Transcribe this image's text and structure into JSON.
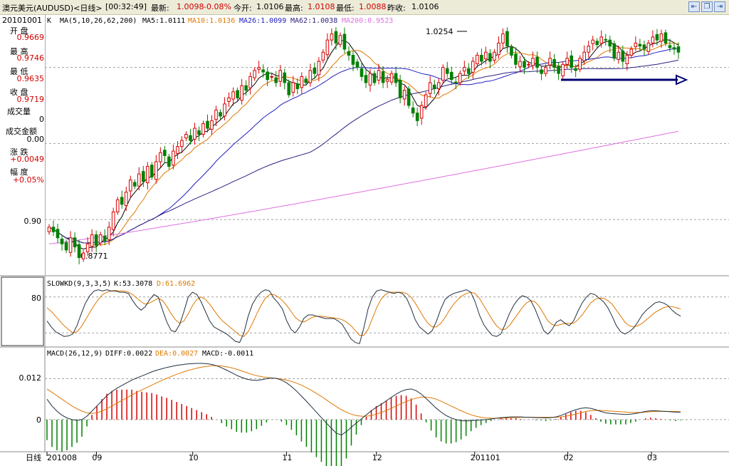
{
  "header": {
    "title": "澳元美元(AUDUSD)<日线>",
    "time": "[00:32:49]",
    "latest_label": "最新:",
    "latest_value": "1.0098",
    "latest_change": "-0.08%",
    "open_label": "今开:",
    "open_value": "1.0106",
    "high_label": "最高:",
    "high_value": "1.0108",
    "low_label": "最低:",
    "low_value": "1.0088",
    "prev_label": "昨收:",
    "prev_value": "1.0106"
  },
  "info_panel": {
    "date": "20101001",
    "k_label": "K",
    "open_label": "开  盘",
    "open_value": "0.9669",
    "high_label": "最  高",
    "high_value": "0.9746",
    "low_label": "最  低",
    "low_value": "0.9635",
    "close_label": "收  盘",
    "close_value": "0.9719",
    "volume_label": "成交量",
    "volume_value": "0",
    "amount_label": "成交金额",
    "amount_value": "0.00",
    "change_label": "涨  跌",
    "change_value": "+0.0049",
    "pct_label": "幅  度",
    "pct_value": "+0.05%"
  },
  "colors": {
    "up": "#d80000",
    "down": "#008000",
    "ma5": "#000000",
    "ma10": "#e07800",
    "ma26": "#2020c0",
    "ma62": "#302080",
    "ma200": "#e070e0",
    "k_line": "#203040",
    "d_line": "#e07800",
    "diff": "#203040",
    "dea": "#e07800",
    "arrow": "#000070",
    "grid": "#a0a0a0"
  },
  "chart_data": [
    {
      "type": "candlestick",
      "legend": {
        "ma_params": "MA(5,10,26,62,200)",
        "ma5": "MA5:1.0111",
        "ma10": "MA10:1.0136",
        "ma26": "MA26:1.0099",
        "ma62": "MA62:1.0038",
        "ma200": "MA200:0.9523"
      },
      "y_ticks": [
        "0.90"
      ],
      "ylim": [
        0.864,
        1.034
      ],
      "annotations": {
        "high": "1.0254",
        "low": "0.8771"
      },
      "closes": [
        0.895,
        0.892,
        0.888,
        0.884,
        0.88,
        0.888,
        0.882,
        0.875,
        0.878,
        0.884,
        0.89,
        0.883,
        0.89,
        0.886,
        0.895,
        0.905,
        0.913,
        0.91,
        0.918,
        0.926,
        0.922,
        0.93,
        0.925,
        0.935,
        0.928,
        0.938,
        0.944,
        0.942,
        0.935,
        0.945,
        0.948,
        0.952,
        0.956,
        0.952,
        0.96,
        0.956,
        0.963,
        0.96,
        0.965,
        0.972,
        0.968,
        0.976,
        0.98,
        0.984,
        0.98,
        0.988,
        0.985,
        0.994,
        0.998,
        1.0,
        0.997,
        0.992,
        0.994,
        0.99,
        0.998,
        0.99,
        0.982,
        0.99,
        0.986,
        0.994,
        0.99,
        0.998,
        0.996,
        1.004,
        1.01,
        1.018,
        1.022,
        1.016,
        1.021,
        1.012,
        1.008,
        1.002,
        1.0,
        0.994,
        0.99,
        0.996,
        0.99,
        0.998,
        0.99,
        0.992,
        0.996,
        0.99,
        0.98,
        0.985,
        0.975,
        0.97,
        0.965,
        0.975,
        0.982,
        0.99,
        0.986,
        0.99,
        1.0,
        0.996,
        0.992,
        0.99,
        0.996,
        1.0,
        0.996,
        1.004,
        1.008,
        1.004,
        1.01,
        1.004,
        1.01,
        1.016,
        1.022,
        1.014,
        1.008,
        1.002,
        1.004,
        1.0,
        1.002,
        1.006,
        1.0,
        0.996,
        1.0,
        1.006,
        1.0,
        0.996,
        1.002,
        1.006,
        1.0,
        0.998,
        1.006,
        1.01,
        1.014,
        1.018,
        1.015,
        1.02,
        1.018,
        1.014,
        1.006,
        1.01,
        1.004,
        1.008,
        1.012,
        1.016,
        1.014,
        1.012,
        1.016,
        1.02,
        1.018,
        1.022,
        1.016,
        1.013,
        1.012,
        1.01
      ]
    },
    {
      "type": "line",
      "legend": {
        "params": "SLOWKD(9,3,3,5)",
        "k": "K:53.3078",
        "d": "D:61.6962"
      },
      "y_ticks": [
        "80"
      ],
      "ylim": [
        0,
        100
      ],
      "series": [
        {
          "name": "K",
          "values": [
            40,
            30,
            22,
            18,
            14,
            15,
            18,
            32,
            52,
            70,
            82,
            90,
            92,
            90,
            92,
            90,
            90,
            88,
            88,
            86,
            74,
            64,
            58,
            64,
            76,
            84,
            80,
            58,
            38,
            24,
            22,
            34,
            56,
            80,
            88,
            84,
            72,
            56,
            40,
            30,
            26,
            22,
            18,
            12,
            6,
            4,
            20,
            48,
            68,
            80,
            88,
            92,
            90,
            78,
            70,
            60,
            40,
            26,
            20,
            30,
            44,
            50,
            50,
            48,
            46,
            44,
            44,
            44,
            40,
            34,
            22,
            10,
            4,
            2,
            28,
            60,
            80,
            90,
            92,
            90,
            88,
            86,
            88,
            86,
            78,
            62,
            42,
            30,
            24,
            18,
            24,
            40,
            60,
            76,
            82,
            86,
            88,
            90,
            92,
            88,
            72,
            50,
            34,
            24,
            16,
            14,
            18,
            34,
            52,
            66,
            76,
            82,
            80,
            74,
            60,
            42,
            24,
            18,
            26,
            38,
            42,
            36,
            32,
            40,
            56,
            70,
            80,
            86,
            84,
            78,
            72,
            62,
            48,
            32,
            22,
            18,
            22,
            28,
            38,
            50,
            58,
            64,
            70,
            72,
            70,
            66,
            58,
            52,
            48
          ]
        },
        {
          "name": "D",
          "values": [
            62,
            56,
            48,
            40,
            32,
            26,
            20,
            22,
            30,
            42,
            54,
            66,
            76,
            84,
            88,
            90,
            91,
            90,
            90,
            88,
            84,
            78,
            72,
            68,
            70,
            74,
            78,
            74,
            64,
            52,
            42,
            36,
            40,
            52,
            66,
            76,
            80,
            76,
            68,
            58,
            48,
            40,
            34,
            28,
            22,
            16,
            14,
            22,
            36,
            52,
            66,
            78,
            84,
            84,
            80,
            74,
            66,
            56,
            46,
            40,
            38,
            42,
            46,
            48,
            48,
            47,
            46,
            45,
            44,
            42,
            38,
            32,
            24,
            16,
            16,
            26,
            44,
            62,
            76,
            84,
            88,
            88,
            88,
            88,
            86,
            80,
            70,
            58,
            46,
            36,
            30,
            30,
            36,
            46,
            58,
            68,
            76,
            82,
            86,
            88,
            86,
            78,
            66,
            54,
            42,
            32,
            26,
            26,
            32,
            42,
            52,
            62,
            70,
            74,
            72,
            64,
            52,
            40,
            34,
            32,
            34,
            36,
            36,
            36,
            42,
            50,
            60,
            70,
            76,
            78,
            78,
            74,
            68,
            58,
            48,
            38,
            32,
            30,
            32,
            36,
            42,
            48,
            54,
            58,
            62,
            64,
            64,
            62,
            60
          ]
        }
      ]
    },
    {
      "type": "bar+line",
      "legend": {
        "params": "MACD(26,12,9)",
        "diff": "DIFF:0.0022",
        "dea": "DEA:0.0027",
        "macd": "MACD:-0.0011"
      },
      "y_ticks": [
        "0.012",
        "0"
      ],
      "ylim": [
        -0.009,
        0.019
      ],
      "series": [
        {
          "name": "DIFF",
          "values": [
            0.006,
            0.004,
            0.0025,
            0.0013,
            0.0005,
            0.0,
            -0.0002,
            0.0,
            0.001,
            0.0025,
            0.004,
            0.0055,
            0.007,
            0.0082,
            0.0092,
            0.01,
            0.0108,
            0.0116,
            0.0122,
            0.0128,
            0.0134,
            0.014,
            0.0145,
            0.0149,
            0.0153,
            0.0156,
            0.0159,
            0.0161,
            0.0163,
            0.0164,
            0.0165,
            0.0165,
            0.0164,
            0.0162,
            0.0158,
            0.0152,
            0.0145,
            0.0138,
            0.013,
            0.0124,
            0.0119,
            0.0116,
            0.0115,
            0.0117,
            0.012,
            0.0122,
            0.0121,
            0.0116,
            0.0108,
            0.0097,
            0.0084,
            0.0069,
            0.0054,
            0.0038,
            0.0022,
            0.0006,
            -0.001,
            -0.0025,
            -0.004,
            -0.0045,
            -0.0035,
            -0.0022,
            -0.001,
            0.0002,
            0.0014,
            0.0026,
            0.0036,
            0.0045,
            0.0055,
            0.0065,
            0.0075,
            0.0083,
            0.0088,
            0.009,
            0.0085,
            0.0075,
            0.0062,
            0.0048,
            0.0034,
            0.0022,
            0.0012,
            0.0005,
            0.0,
            -0.0003,
            -0.0004,
            -0.0003,
            -0.0002,
            -0.0001,
            0.0,
            0.0002,
            0.0004,
            0.0006,
            0.0007,
            0.0008,
            0.0008,
            0.0008,
            0.0007,
            0.0007,
            0.0006,
            0.0006,
            0.0005,
            0.0006,
            0.0008,
            0.0012,
            0.0018,
            0.0024,
            0.0029,
            0.0033,
            0.0035,
            0.0033,
            0.0029,
            0.0024,
            0.002,
            0.0018,
            0.0017,
            0.0016,
            0.0015,
            0.0016,
            0.0018,
            0.0021,
            0.0024,
            0.0026,
            0.0026,
            0.0025,
            0.0024,
            0.0023,
            0.0022,
            0.0022
          ]
        },
        {
          "name": "DEA",
          "values": [
            0.009,
            0.008,
            0.007,
            0.006,
            0.005,
            0.004,
            0.0032,
            0.0025,
            0.002,
            0.0018,
            0.002,
            0.0025,
            0.0032,
            0.004,
            0.0048,
            0.0056,
            0.0064,
            0.0072,
            0.008,
            0.0087,
            0.0094,
            0.0101,
            0.0108,
            0.0115,
            0.0121,
            0.0127,
            0.0133,
            0.0138,
            0.0143,
            0.0147,
            0.0151,
            0.0154,
            0.0156,
            0.0158,
            0.0158,
            0.0157,
            0.0155,
            0.0152,
            0.0148,
            0.0143,
            0.0138,
            0.0133,
            0.0129,
            0.0126,
            0.0124,
            0.0122,
            0.0121,
            0.0119,
            0.0116,
            0.0112,
            0.0107,
            0.0101,
            0.0094,
            0.0086,
            0.0077,
            0.0068,
            0.0058,
            0.0048,
            0.0038,
            0.0029,
            0.0022,
            0.0016,
            0.0012,
            0.001,
            0.001,
            0.0012,
            0.0016,
            0.0021,
            0.0027,
            0.0033,
            0.004,
            0.0047,
            0.0053,
            0.0059,
            0.0063,
            0.0066,
            0.0066,
            0.0064,
            0.006,
            0.0054,
            0.0047,
            0.004,
            0.0033,
            0.0026,
            0.002,
            0.0014,
            0.001,
            0.0007,
            0.0005,
            0.0004,
            0.0004,
            0.0004,
            0.0005,
            0.0006,
            0.0006,
            0.0007,
            0.0007,
            0.0007,
            0.0007,
            0.0007,
            0.0007,
            0.0007,
            0.0007,
            0.0008,
            0.001,
            0.0013,
            0.0016,
            0.002,
            0.0024,
            0.0026,
            0.0027,
            0.0027,
            0.0026,
            0.0025,
            0.0024,
            0.0023,
            0.0022,
            0.0021,
            0.0021,
            0.0021,
            0.0022,
            0.0023,
            0.0024,
            0.0024,
            0.0024,
            0.0024,
            0.0024,
            0.0023
          ]
        }
      ]
    }
  ],
  "x_axis": {
    "label": "日线",
    "ticks": [
      {
        "label": "201008",
        "pos": 0.0
      },
      {
        "label": "09",
        "pos": 0.078
      },
      {
        "label": "10",
        "pos": 0.23
      },
      {
        "label": "11",
        "pos": 0.378
      },
      {
        "label": "12",
        "pos": 0.52
      },
      {
        "label": "201101",
        "pos": 0.675
      },
      {
        "label": "02",
        "pos": 0.822
      },
      {
        "label": "03",
        "pos": 0.954
      }
    ]
  }
}
